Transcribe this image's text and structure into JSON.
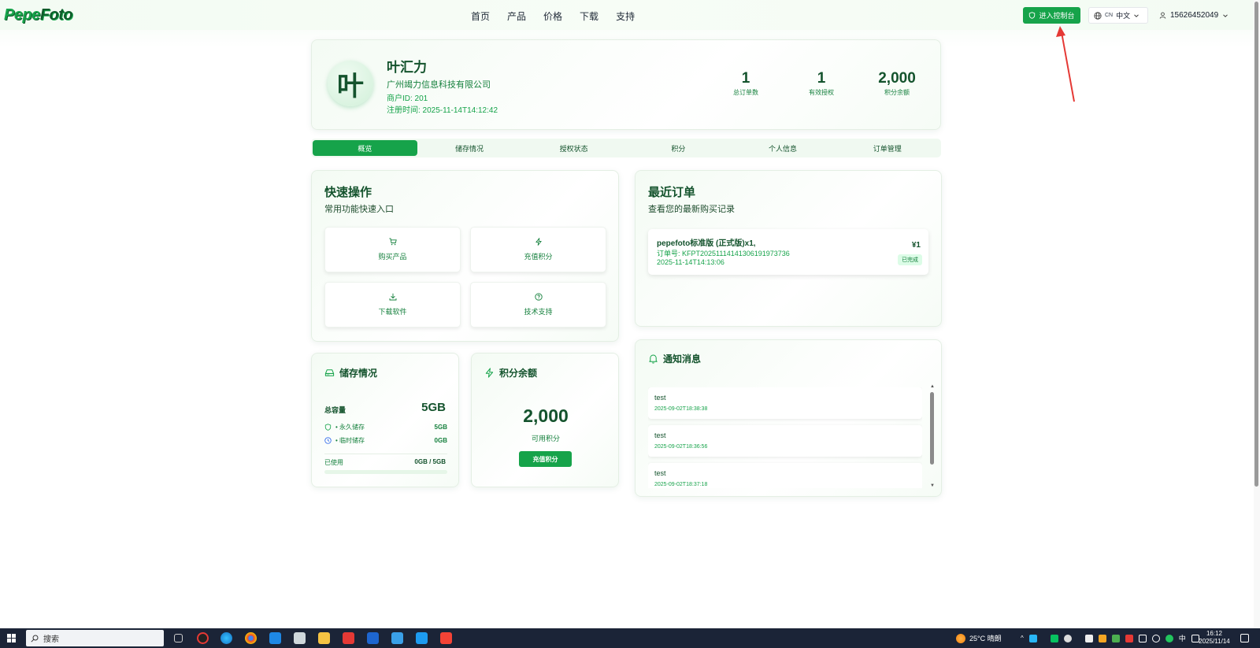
{
  "header": {
    "logo": {
      "part1": "Pepe",
      "part2": "Foto"
    },
    "nav": [
      "首页",
      "产品",
      "价格",
      "下载",
      "支持"
    ],
    "console_button": "进入控制台",
    "lang": {
      "code": "CN",
      "label": "中文"
    },
    "user_phone": "15626452049"
  },
  "profile": {
    "avatar_char": "叶",
    "name": "叶汇力",
    "company": "广州竭力信息科技有限公司",
    "merchant_id": "商户ID: 201",
    "registered": "注册时间: 2025-11-14T14:12:42",
    "stats": [
      {
        "value": "1",
        "label": "总订单数"
      },
      {
        "value": "1",
        "label": "有效授权"
      },
      {
        "value": "2,000",
        "label": "积分余额"
      }
    ]
  },
  "tabs": [
    "概览",
    "储存情况",
    "授权状态",
    "积分",
    "个人信息",
    "订单管理"
  ],
  "quick_actions": {
    "title": "快速操作",
    "subtitle": "常用功能快速入口",
    "items": [
      {
        "icon": "cart-icon",
        "label": "购买产品"
      },
      {
        "icon": "lightning-icon",
        "label": "充值积分"
      },
      {
        "icon": "download-icon",
        "label": "下载软件"
      },
      {
        "icon": "help-circle-icon",
        "label": "技术支持"
      }
    ]
  },
  "orders": {
    "title": "最近订单",
    "subtitle": "查看您的最新购买记录",
    "items": [
      {
        "name": "pepefoto标准版 (正式版)x1,",
        "order_no": "订单号: KFPT20251114141306191973736",
        "time": "2025-11-14T14:13:06",
        "price": "¥1",
        "status": "已完成"
      }
    ]
  },
  "storage": {
    "title": "储存情况",
    "total_label": "总容量",
    "total_value": "5GB",
    "permanent_label": "• 永久储存",
    "permanent_value": "5GB",
    "temp_label": "• 临时储存",
    "temp_value": "0GB",
    "used_label": "已使用",
    "used_value": "0GB / 5GB",
    "used_fraction": 0
  },
  "points": {
    "title": "积分余额",
    "value": "2,000",
    "label": "可用积分",
    "button": "充值积分"
  },
  "notifications": {
    "title": "通知消息",
    "items": [
      {
        "title": "test",
        "time": "2025-09-02T18:38:38"
      },
      {
        "title": "test",
        "time": "2025-09-02T18:36:56"
      },
      {
        "title": "test",
        "time": "2025-09-02T18:37:18"
      }
    ]
  },
  "taskbar": {
    "search_placeholder": "搜索",
    "weather": "25°C 晴朗",
    "ime": "中",
    "time": "16:12",
    "date": "2025/11/14"
  },
  "colors": {
    "accent": "#16a34a",
    "text_dark": "#14532d",
    "annotation_arrow": "#e53935"
  }
}
